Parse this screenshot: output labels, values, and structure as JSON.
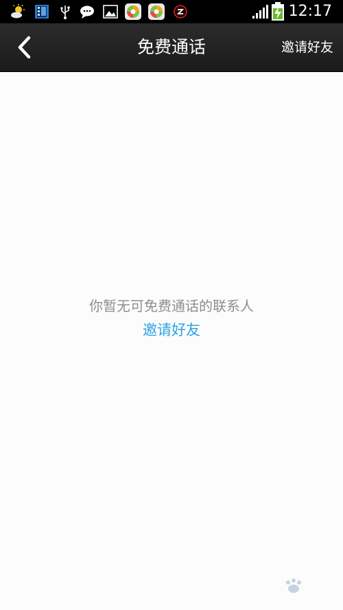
{
  "status_bar": {
    "time": "12:17",
    "notification_icons": [
      "weather-icon",
      "calendar-icon",
      "usb-icon",
      "chat-icon",
      "gallery-icon",
      "app-icon",
      "app-icon",
      "shield-icon"
    ],
    "signal_icon": "signal-icon",
    "battery_icon": "battery-charging-icon"
  },
  "action_bar": {
    "back_icon": "chevron-left-icon",
    "title": "免费通话",
    "invite_label": "邀请好友"
  },
  "content": {
    "empty_message": "你暂无可免费通话的联系人",
    "invite_link": "邀请好友"
  },
  "colors": {
    "link": "#2ea3e3",
    "empty_text": "#8e8e8e",
    "action_bar": "#222222"
  }
}
